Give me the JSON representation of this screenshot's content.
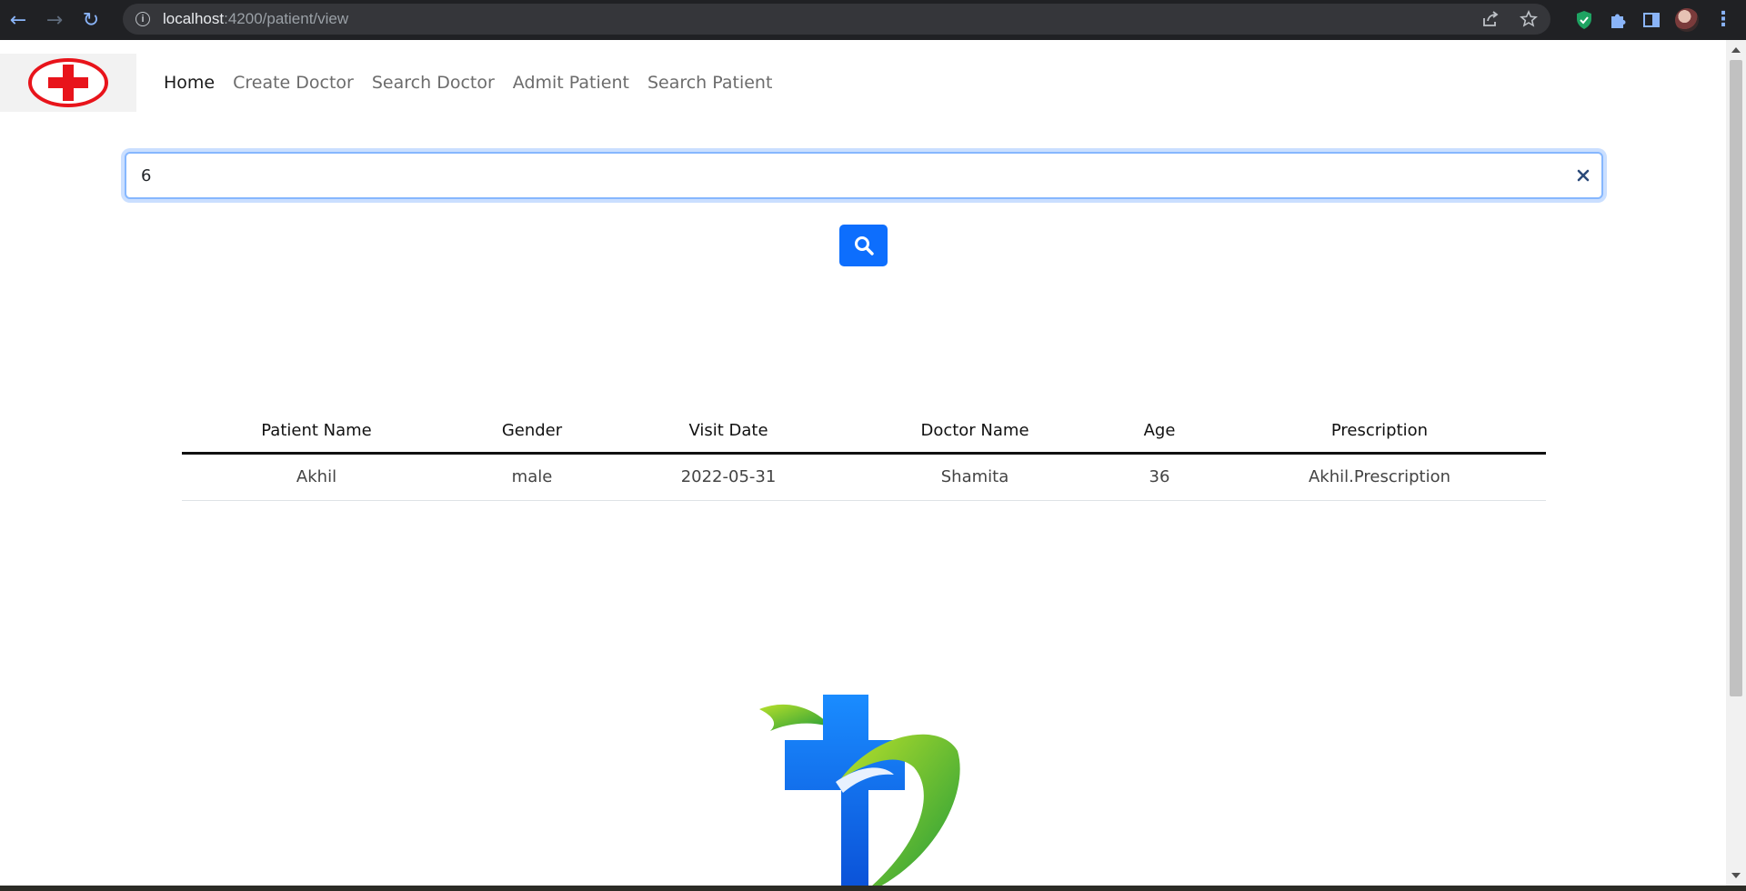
{
  "browser": {
    "url_host": "localhost",
    "url_path": ":4200/patient/view"
  },
  "navbar": {
    "logo_icon": "red-cross-logo-icon",
    "links": [
      {
        "label": "Home",
        "active": true
      },
      {
        "label": "Create Doctor",
        "active": false
      },
      {
        "label": "Search Doctor",
        "active": false
      },
      {
        "label": "Admit Patient",
        "active": false
      },
      {
        "label": "Search Patient",
        "active": false
      }
    ]
  },
  "search": {
    "value": "6",
    "clear_icon": "close-icon",
    "button_icon": "search-icon"
  },
  "table": {
    "headers": [
      "Patient Name",
      "Gender",
      "Visit Date",
      "Doctor Name",
      "Age",
      "Prescription"
    ],
    "rows": [
      [
        "Akhil",
        "male",
        "2022-05-31",
        "Shamita",
        "36",
        "Akhil.Prescription"
      ]
    ]
  },
  "footer": {
    "logo_icon": "medical-cross-leaf-logo-icon"
  },
  "colors": {
    "primary": "#0d6efd",
    "logo_red": "#e8141b",
    "focus_border": "#86b7fe"
  }
}
